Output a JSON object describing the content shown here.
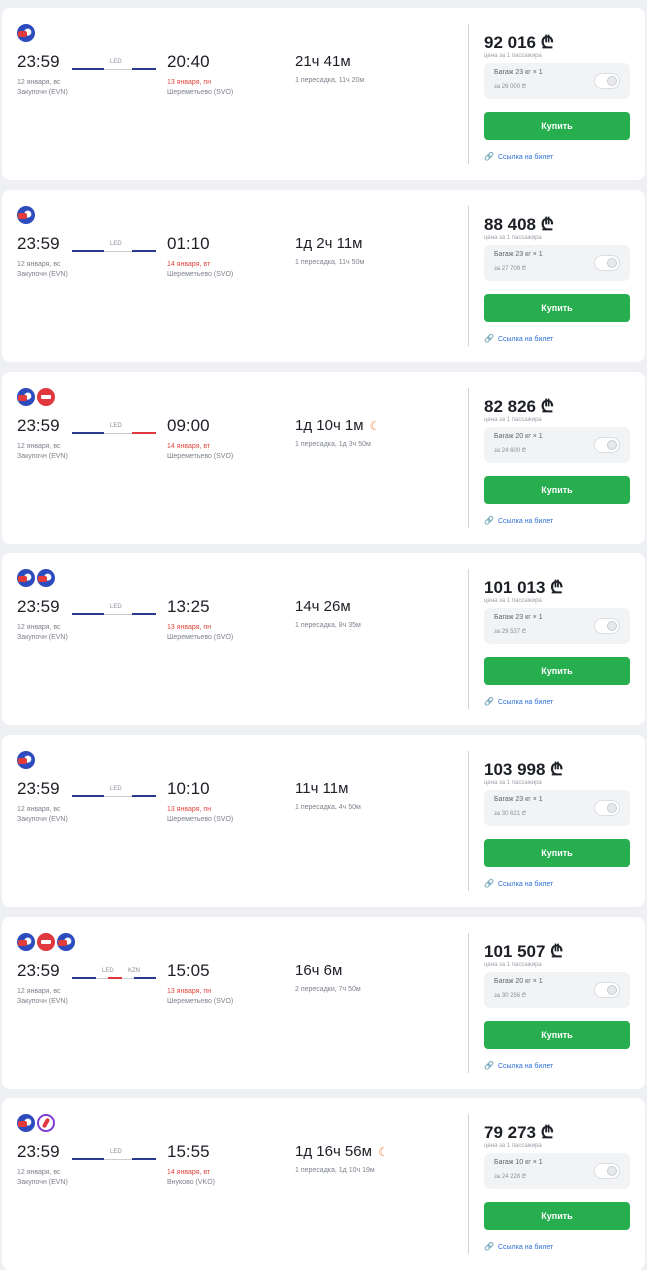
{
  "tickets": [
    {
      "logos": [
        "blue"
      ],
      "dep_time": "23:59",
      "dep_date": "12 января, вс",
      "dep_airport": "Закупочн (EVN)",
      "arr_time": "20:40",
      "arr_date": "13 января, пн",
      "arr_airport": "Шереметьево (SVO)",
      "stops": [
        "LED"
      ],
      "duration": "21ч 41м",
      "night": false,
      "transfers": "1 пересадка, 11ч 20м",
      "price": "92 016 ₾",
      "price_note": "цена за 1 пассажира",
      "bag_line1": "Багаж 23 кг × 1",
      "bag_line2": "за 26 000 ₾",
      "buy_label": "Купить",
      "link_icon": "🔗",
      "link_label": "Ссылка на билет"
    },
    {
      "logos": [
        "blue"
      ],
      "dep_time": "23:59",
      "dep_date": "12 января, вс",
      "dep_airport": "Закупочн (EVN)",
      "arr_time": "01:10",
      "arr_date": "14 января, вт",
      "arr_airport": "Шереметьево (SVO)",
      "stops": [
        "LED"
      ],
      "duration": "1д 2ч 11м",
      "night": false,
      "transfers": "1 пересадка, 11ч 50м",
      "price": "88 408 ₾",
      "price_note": "цена за 1 пассажира",
      "bag_line1": "Багаж 23 кг × 1",
      "bag_line2": "за 27 709 ₾",
      "buy_label": "Купить",
      "link_icon": "🔗",
      "link_label": "Ссылка на билет"
    },
    {
      "logos": [
        "blue",
        "red"
      ],
      "dep_time": "23:59",
      "dep_date": "12 января, вс",
      "dep_airport": "Закупочн (EVN)",
      "arr_time": "09:00",
      "arr_date": "14 января, вт",
      "arr_airport": "Шереметьево (SVO)",
      "stops": [
        "LED"
      ],
      "duration": "1д 10ч 1м",
      "night": true,
      "transfers": "1 пересадка, 1д 3ч 50м",
      "price": "82 826 ₾",
      "price_note": "цена за 1 пассажира",
      "bag_line1": "Багаж 20 кг × 1",
      "bag_line2": "за 24 600 ₾",
      "buy_label": "Купить",
      "link_icon": "🔗",
      "link_label": "Ссылка на билет"
    },
    {
      "logos": [
        "blue",
        "blue"
      ],
      "dep_time": "23:59",
      "dep_date": "12 января, вс",
      "dep_airport": "Закупочн (EVN)",
      "arr_time": "13:25",
      "arr_date": "13 января, пн",
      "arr_airport": "Шереметьево (SVO)",
      "stops": [
        "LED"
      ],
      "duration": "14ч 26м",
      "night": false,
      "transfers": "1 пересадка, 8ч 35м",
      "price": "101 013 ₾",
      "price_note": "цена за 1 пассажира",
      "bag_line1": "Багаж 23 кг × 1",
      "bag_line2": "за 29 537 ₾",
      "buy_label": "Купить",
      "link_icon": "🔗",
      "link_label": "Ссылка на билет"
    },
    {
      "logos": [
        "blue"
      ],
      "dep_time": "23:59",
      "dep_date": "12 января, вс",
      "dep_airport": "Закупочн (EVN)",
      "arr_time": "10:10",
      "arr_date": "13 января, пн",
      "arr_airport": "Шереметьево (SVO)",
      "stops": [
        "LED"
      ],
      "duration": "11ч 11м",
      "night": false,
      "transfers": "1 пересадка, 4ч 50м",
      "price": "103 998 ₾",
      "price_note": "цена за 1 пассажира",
      "bag_line1": "Багаж 23 кг × 1",
      "bag_line2": "за 30 621 ₾",
      "buy_label": "Купить",
      "link_icon": "🔗",
      "link_label": "Ссылка на билет"
    },
    {
      "logos": [
        "blue",
        "red",
        "blue"
      ],
      "dep_time": "23:59",
      "dep_date": "12 января, вс",
      "dep_airport": "Закупочн (EVN)",
      "arr_time": "15:05",
      "arr_date": "13 января, пн",
      "arr_airport": "Шереметьево (SVO)",
      "stops": [
        "LED",
        "KZN"
      ],
      "duration": "16ч 6м",
      "night": false,
      "transfers": "2 пересадки, 7ч 50м",
      "price": "101 507 ₾",
      "price_note": "цена за 1 пассажира",
      "bag_line1": "Багаж 20 кг × 1",
      "bag_line2": "за 30 256 ₾",
      "buy_label": "Купить",
      "link_icon": "🔗",
      "link_label": "Ссылка на билет"
    },
    {
      "logos": [
        "blue",
        "purple"
      ],
      "dep_time": "23:59",
      "dep_date": "12 января, вс",
      "dep_airport": "Закупочн (EVN)",
      "arr_time": "15:55",
      "arr_date": "14 января, вт",
      "arr_airport": "Внуково (VKO)",
      "stops": [
        "LED"
      ],
      "duration": "1д 16ч 56м",
      "night": true,
      "transfers": "1 пересадка, 1д 10ч 19м",
      "price": "79 273 ₾",
      "price_note": "цена за 1 пассажира",
      "bag_line1": "Багаж 10 кг × 1",
      "bag_line2": "за 24 228 ₾",
      "buy_label": "Купить",
      "link_icon": "🔗",
      "link_label": "Ссылка на билет"
    }
  ],
  "moon_icon": "☾"
}
